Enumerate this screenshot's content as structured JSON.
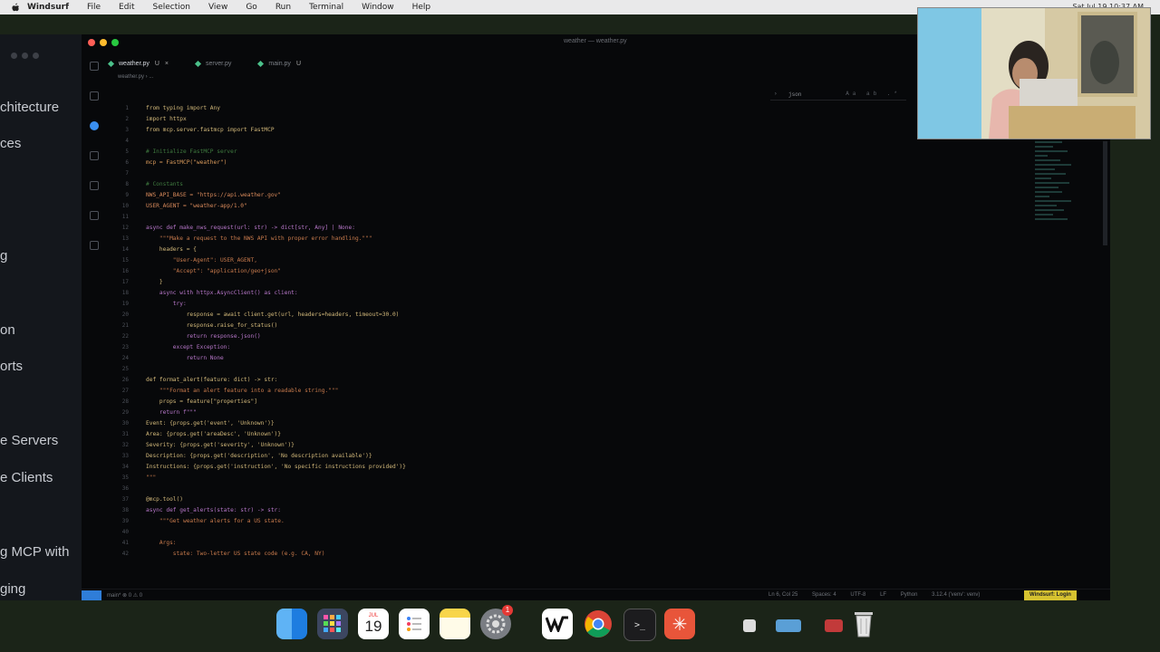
{
  "menubar": {
    "app_name": "Windsurf",
    "items": [
      "File",
      "Edit",
      "Selection",
      "View",
      "Go",
      "Run",
      "Terminal",
      "Window",
      "Help"
    ],
    "clock": "Sat Jul 19 10:37 AM"
  },
  "back_window": {
    "items": [
      "chitecture",
      "ces",
      "",
      "g",
      "",
      "on",
      "orts",
      "",
      "e Servers",
      "e Clients",
      "",
      "g MCP with",
      "ging"
    ]
  },
  "editor": {
    "window_title": "weather — weather.py",
    "tabs": [
      {
        "label": "weather.py",
        "badge": "U",
        "active": true
      },
      {
        "label": "server.py",
        "badge": "",
        "active": false
      },
      {
        "label": "main.py",
        "badge": "U",
        "active": false
      }
    ],
    "breadcrumb": "weather.py  ›  ...",
    "find_query": "json",
    "find_options": "Aa ab .*",
    "code_lines": [
      {
        "n": "1",
        "t": "from typing import Any",
        "c": "#d2b87a"
      },
      {
        "n": "2",
        "t": "import httpx",
        "c": "#d2b87a"
      },
      {
        "n": "3",
        "t": "from mcp.server.fastmcp import FastMCP",
        "c": "#d2b87a"
      },
      {
        "n": "4",
        "t": "",
        "c": "#ccc"
      },
      {
        "n": "5",
        "t": "# Initialize FastMCP server",
        "c": "#3f7a3f"
      },
      {
        "n": "6",
        "t": "mcp = FastMCP(\"weather\")",
        "c": "#d99a5b"
      },
      {
        "n": "7",
        "t": "",
        "c": "#ccc"
      },
      {
        "n": "8",
        "t": "# Constants",
        "c": "#3f7a3f"
      },
      {
        "n": "9",
        "t": "NWS_API_BASE = \"https://api.weather.gov\"",
        "c": "#d98a5b"
      },
      {
        "n": "10",
        "t": "USER_AGENT = \"weather-app/1.0\"",
        "c": "#d98a5b"
      },
      {
        "n": "11",
        "t": "",
        "c": "#ccc"
      },
      {
        "n": "12",
        "t": "async def make_nws_request(url: str) -> dict[str, Any] | None:",
        "c": "#b777c9"
      },
      {
        "n": "13",
        "t": "    \"\"\"Make a request to the NWS API with proper error handling.\"\"\"",
        "c": "#c77a4c"
      },
      {
        "n": "14",
        "t": "    headers = {",
        "c": "#d2b87a"
      },
      {
        "n": "15",
        "t": "        \"User-Agent\": USER_AGENT,",
        "c": "#c77a4c"
      },
      {
        "n": "16",
        "t": "        \"Accept\": \"application/geo+json\"",
        "c": "#c77a4c"
      },
      {
        "n": "17",
        "t": "    }",
        "c": "#d2b87a"
      },
      {
        "n": "18",
        "t": "    async with httpx.AsyncClient() as client:",
        "c": "#b777c9"
      },
      {
        "n": "19",
        "t": "        try:",
        "c": "#b777c9"
      },
      {
        "n": "20",
        "t": "            response = await client.get(url, headers=headers, timeout=30.0)",
        "c": "#d2b87a"
      },
      {
        "n": "21",
        "t": "            response.raise_for_status()",
        "c": "#d2b87a"
      },
      {
        "n": "22",
        "t": "            return response.json()",
        "c": "#b777c9"
      },
      {
        "n": "23",
        "t": "        except Exception:",
        "c": "#b777c9"
      },
      {
        "n": "24",
        "t": "            return None",
        "c": "#b777c9"
      },
      {
        "n": "25",
        "t": "",
        "c": "#ccc"
      },
      {
        "n": "26",
        "t": "def format_alert(feature: dict) -> str:",
        "c": "#d2b87a"
      },
      {
        "n": "27",
        "t": "    \"\"\"Format an alert feature into a readable string.\"\"\"",
        "c": "#c77a4c"
      },
      {
        "n": "28",
        "t": "    props = feature[\"properties\"]",
        "c": "#d2b87a"
      },
      {
        "n": "29",
        "t": "    return f\"\"\"",
        "c": "#b777c9"
      },
      {
        "n": "30",
        "t": "Event: {props.get('event', 'Unknown')}",
        "c": "#d2b87a"
      },
      {
        "n": "31",
        "t": "Area: {props.get('areaDesc', 'Unknown')}",
        "c": "#d2b87a"
      },
      {
        "n": "32",
        "t": "Severity: {props.get('severity', 'Unknown')}",
        "c": "#d2b87a"
      },
      {
        "n": "33",
        "t": "Description: {props.get('description', 'No description available')}",
        "c": "#d2b87a"
      },
      {
        "n": "34",
        "t": "Instructions: {props.get('instruction', 'No specific instructions provided')}",
        "c": "#d2b87a"
      },
      {
        "n": "35",
        "t": "\"\"\"",
        "c": "#c77a4c"
      },
      {
        "n": "36",
        "t": "",
        "c": "#ccc"
      },
      {
        "n": "37",
        "t": "@mcp.tool()",
        "c": "#d2b87a"
      },
      {
        "n": "38",
        "t": "async def get_alerts(state: str) -> str:",
        "c": "#b777c9"
      },
      {
        "n": "39",
        "t": "    \"\"\"Get weather alerts for a US state.",
        "c": "#c77a4c"
      },
      {
        "n": "40",
        "t": "",
        "c": "#ccc"
      },
      {
        "n": "41",
        "t": "    Args:",
        "c": "#c77a4c"
      },
      {
        "n": "42",
        "t": "        state: Two-letter US state code (e.g. CA, NY)",
        "c": "#c77a4c"
      }
    ],
    "status": {
      "branch": "main*  ⊗ 0 ⚠ 0",
      "cursor": "Ln 6, Col 25",
      "spaces": "Spaces: 4",
      "encoding": "UTF-8",
      "eol": "LF",
      "language": "Python",
      "interpreter": "3.12.4 ('venv': venv)",
      "login": "Windsurf: Login"
    }
  },
  "dock": {
    "calendar_day": "19",
    "calendar_month": "JUL",
    "chrome_badge": "1",
    "apps": [
      "finder",
      "launchpad",
      "calendar",
      "reminders",
      "notes",
      "system-settings",
      "windsurf",
      "chrome",
      "terminal",
      "claude",
      "trash"
    ]
  },
  "colors": {
    "accent": "#2f7dd8",
    "login_bg": "#d6c230",
    "tab_icon": "#4bc08a"
  }
}
